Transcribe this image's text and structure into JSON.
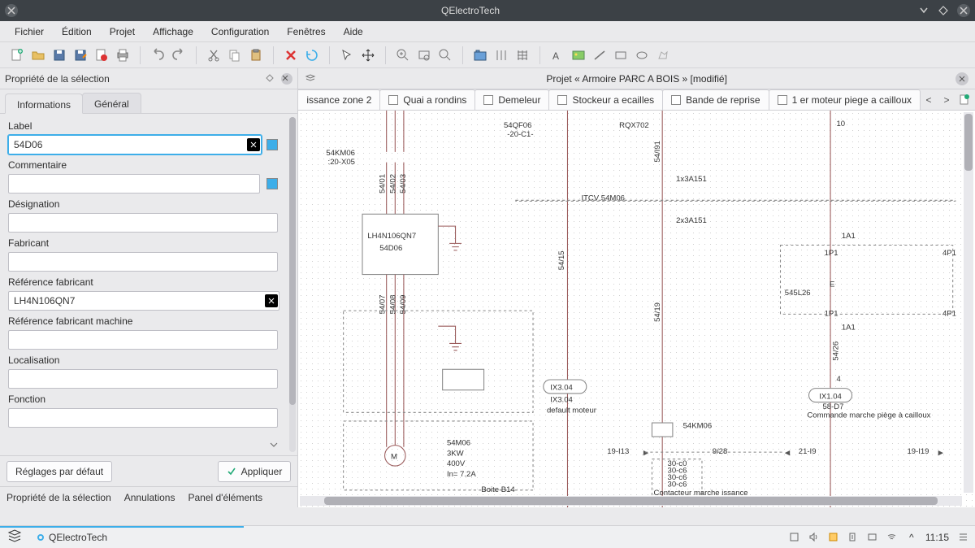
{
  "window": {
    "title": "QElectroTech"
  },
  "menu": [
    "Fichier",
    "Édition",
    "Projet",
    "Affichage",
    "Configuration",
    "Fenêtres",
    "Aide"
  ],
  "panel": {
    "title": "Propriété de la sélection",
    "tabs": [
      "Informations",
      "Général"
    ],
    "active_tab": 0,
    "fields": {
      "label_lbl": "Label",
      "label_val": "54D06",
      "commentaire_lbl": "Commentaire",
      "commentaire_val": "",
      "designation_lbl": "Désignation",
      "designation_val": "",
      "fabricant_lbl": "Fabricant",
      "fabricant_val": "",
      "ref_fab_lbl": "Référence fabricant",
      "ref_fab_val": "LH4N106QN7",
      "ref_mach_lbl": "Référence fabricant machine",
      "ref_mach_val": "",
      "localisation_lbl": "Localisation",
      "localisation_val": "",
      "fonction_lbl": "Fonction",
      "fonction_val": ""
    },
    "btn_defaults": "Réglages par défaut",
    "btn_apply": "Appliquer",
    "bottom_tabs": [
      "Propriété de la sélection",
      "Annulations",
      "Panel d'éléments"
    ]
  },
  "editor": {
    "project_title": "Projet « Armoire PARC A BOIS » [modifié]",
    "sheet_tabs": [
      "issance zone 2",
      "Quai a rondins",
      "Demeleur",
      "Stockeur a ecailles",
      "Bande de reprise",
      "1 er moteur piege a cailloux"
    ]
  },
  "schematic": {
    "lbl_54QF06": "54QF06",
    "lbl_RQX702": "RQX702",
    "lbl_54KM06": "54KM06",
    "lbl_LH4N": "LH4N106QN7",
    "lbl_54D06": "54D06",
    "lbl_ITCV": "ITCV 54M06",
    "lbl_1x3A151": "1x3A151",
    "lbl_2x3A151": "2x3A151",
    "lbl_1A1": "1A1",
    "lbl_1P1": "1P1",
    "lbl_4P1": "4P1",
    "lbl_545L26": "545L26",
    "lbl_IX304": "IX3.04",
    "lbl_IX304b": "IX3.04",
    "lbl_defmot": "default moteur",
    "lbl_IX104": "IX1.04",
    "lbl_58D7": "58-D7",
    "lbl_cmd": "Commande marche\npiège à cailloux",
    "lbl_54KM06b": "54KM06",
    "lbl_54M06": "54M06",
    "lbl_3KW": "3KW",
    "lbl_400V": "400V",
    "lbl_In": "In= 7.2A",
    "lbl_Boite": "Boite B14",
    "lbl_19I13": "19-I13",
    "lbl_21I9": "21-I9",
    "lbl_19I19": "19-I19",
    "lbl_928": "9/28",
    "lbl_5415": "54/15",
    "lbl_5419": "54/19",
    "lbl_5426": "54/26",
    "lbl_54I91": "54/I91",
    "lbl_5401": "54/01",
    "lbl_5402": "54/02",
    "lbl_5403": "54/03",
    "lbl_5407": "54/07",
    "lbl_5408": "54/08",
    "lbl_5409": "54/09",
    "lbl_4": "4",
    "lbl_10": "10",
    "lbl_cont": "Contacteur\nmarche\nissance",
    "lbl_20c1": "-20-C1-",
    "lbl_20x05": ":20-X05"
  },
  "taskbar": {
    "app": "QElectroTech",
    "time": "11:15"
  }
}
